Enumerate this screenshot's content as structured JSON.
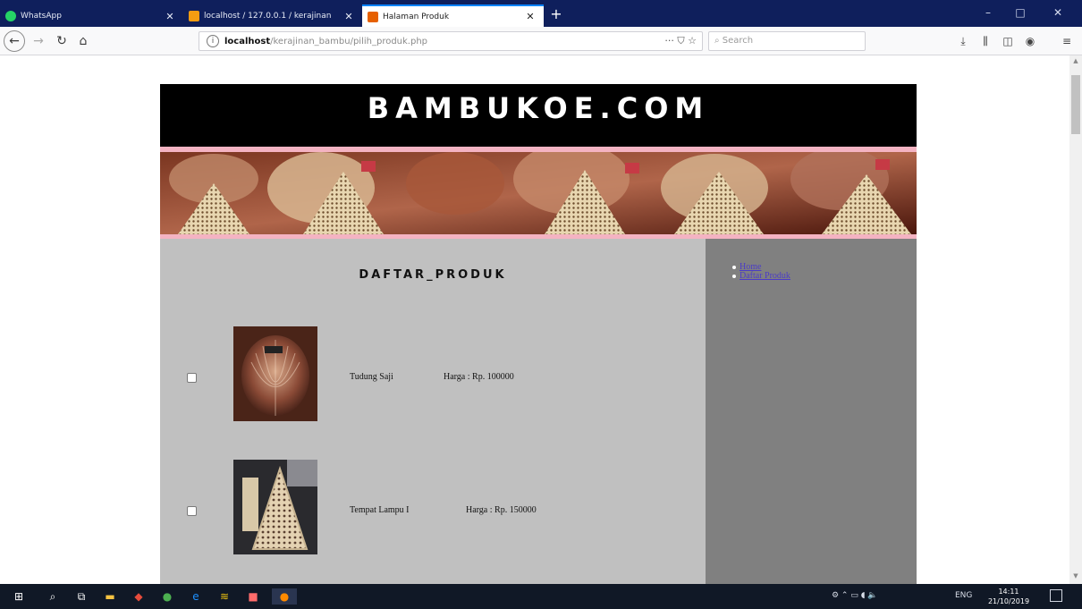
{
  "browser": {
    "tabs": [
      {
        "title": "WhatsApp",
        "favicon_color": "#25d366"
      },
      {
        "title": "localhost / 127.0.0.1 / kerajinan",
        "favicon_color": "#f39c12"
      },
      {
        "title": "Halaman Produk",
        "favicon_color": "#e66000",
        "active": true
      }
    ],
    "new_tab": "+",
    "window_controls": {
      "minimize": "–",
      "maximize": "□",
      "close": "✕"
    },
    "url": {
      "host": "localhost",
      "path": "/kerajinan_bambu/pilih_produk.php"
    },
    "url_actions": "··· ⛉ ☆",
    "search_placeholder": "Search",
    "toolbar_icons": [
      "download-icon",
      "library-icon",
      "sidebar-icon",
      "account-icon",
      "menu-icon"
    ]
  },
  "site": {
    "title": "BAMBUKOE.COM",
    "section_title": "DAFTAR_PRODUK",
    "nav": [
      {
        "label": "Home"
      },
      {
        "label": "Daftar Produk"
      }
    ],
    "products": [
      {
        "name": "Tudung Saji",
        "price": "Harga : Rp. 100000"
      },
      {
        "name": "Tempat Lampu I",
        "price": "Harga : Rp. 150000"
      }
    ]
  },
  "colors": {
    "header_bg": "#000000",
    "pink_stripe": "#f4b3c2",
    "content_bg": "#c0c0c0",
    "sidebar_bg": "#808080",
    "link": "#4b3cc6"
  },
  "taskbar": {
    "tray_lang": "ENG",
    "time": "14:11",
    "date": "21/10/2019"
  }
}
